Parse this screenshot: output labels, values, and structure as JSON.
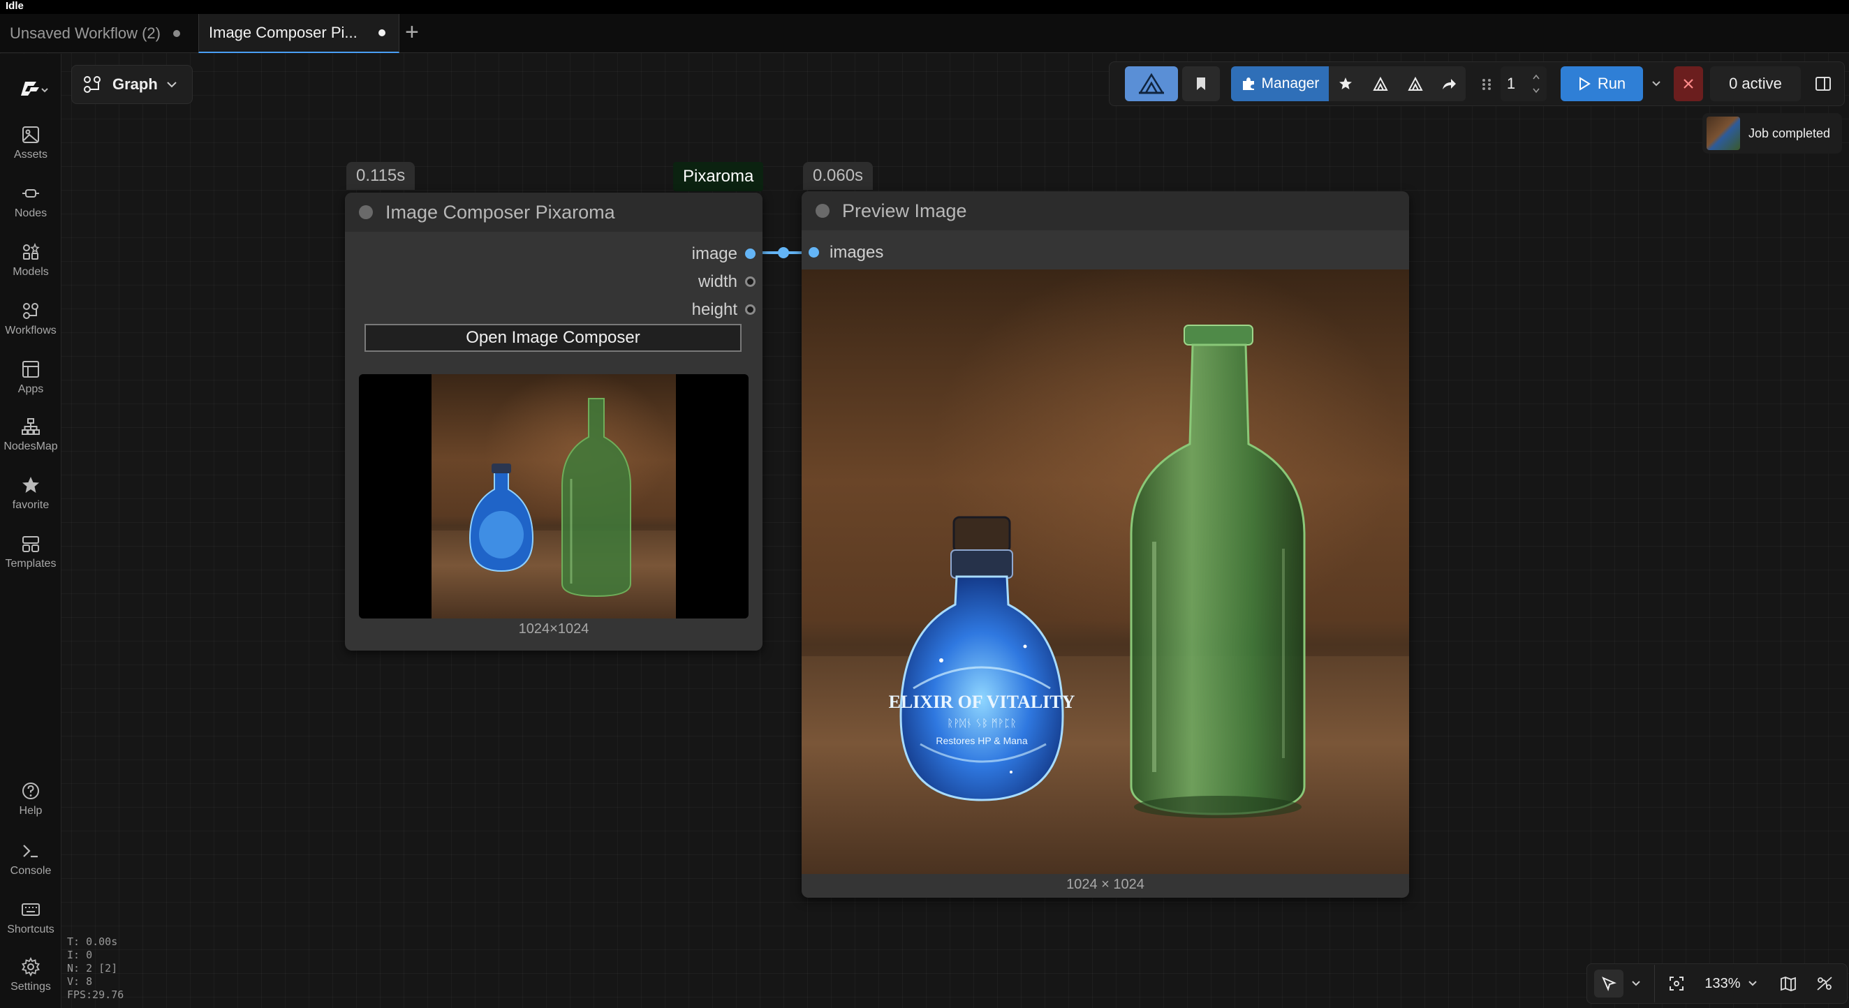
{
  "status": "Idle",
  "tabs": [
    {
      "label": "Unsaved Workflow (2)",
      "active": false
    },
    {
      "label": "Image Composer Pi...",
      "active": true
    }
  ],
  "sidebar": {
    "items": [
      {
        "label": "Assets",
        "icon": "image-icon"
      },
      {
        "label": "Nodes",
        "icon": "node-icon"
      },
      {
        "label": "Models",
        "icon": "models-icon"
      },
      {
        "label": "Workflows",
        "icon": "workflows-icon"
      },
      {
        "label": "Apps",
        "icon": "apps-icon"
      },
      {
        "label": "NodesMap",
        "icon": "sitemap-icon"
      },
      {
        "label": "favorite",
        "icon": "star-icon"
      },
      {
        "label": "Templates",
        "icon": "templates-icon"
      }
    ],
    "bottom_items": [
      {
        "label": "Help",
        "icon": "help-icon"
      },
      {
        "label": "Console",
        "icon": "terminal-icon"
      },
      {
        "label": "Shortcuts",
        "icon": "keyboard-icon"
      },
      {
        "label": "Settings",
        "icon": "gear-icon"
      }
    ]
  },
  "graph_selector": {
    "label": "Graph"
  },
  "toolbar": {
    "manager_label": "Manager",
    "queue_count": "1",
    "run_label": "Run",
    "active_label": "0 active"
  },
  "job_toast": {
    "text": "Job completed"
  },
  "node_composer": {
    "time": "0.115s",
    "title": "Image Composer Pixaroma",
    "outputs": [
      "image",
      "width",
      "height"
    ],
    "button_label": "Open Image Composer",
    "dimensions": "1024×1024"
  },
  "pixaroma_badge": "Pixaroma",
  "node_preview": {
    "time": "0.060s",
    "title": "Preview Image",
    "input": "images",
    "dimensions": "1024 × 1024"
  },
  "bottle_label": {
    "line1": "ELIXIR OF VITALITY",
    "line2": "ᚱᚹᛞᚾ ᛊᛒ ᛗᚹᛈᚱ",
    "line3": "Restores HP & Mana"
  },
  "stats": {
    "t": "T: 0.00s",
    "i": "I: 0",
    "n": "N: 2 [2]",
    "v": "V: 8",
    "fps": "FPS:29.76"
  },
  "canvas_controls": {
    "zoom": "133%"
  }
}
